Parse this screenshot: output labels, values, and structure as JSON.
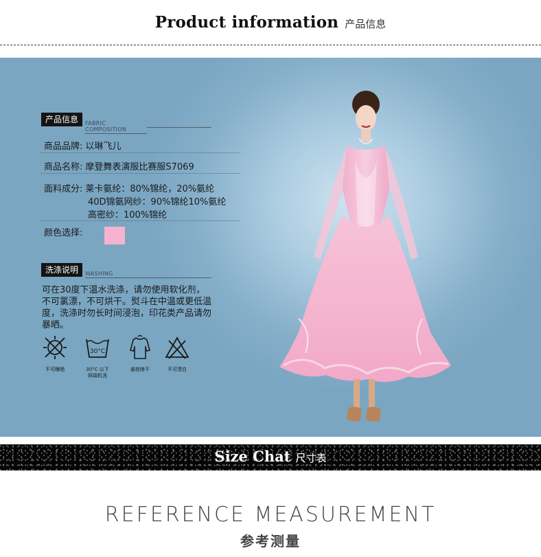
{
  "header": {
    "title_en": "Product  information",
    "title_cn": "产品信息"
  },
  "product_info": {
    "tag_label": "产品信息",
    "tag_sub": "FABRIC COMPOSITION",
    "brand_label": "商品品牌:",
    "brand_value": "以琳飞儿",
    "name_label": "商品名称:",
    "name_value": "摩登舞表演服比赛服S7069",
    "fabric_label": "面料成分:",
    "fabric_lines": [
      "莱卡氨纶：80%锦纶，20%氨纶",
      "40D锦氨网纱：90%锦纶10%氨纶",
      "高密纱：100%锦纶"
    ],
    "color_label": "颜色选择:",
    "color_swatch": "#f5b3cf"
  },
  "washing": {
    "tag_label": "洗涤说明",
    "tag_sub": "WASHING",
    "text": "可在30度下温水洗涤，请勿使用软化剂，不可氯漂，不可烘干。熨斗在中温或更低温度，洗涤时勿长时间浸泡，印花类产品请勿暴晒。",
    "icons": [
      {
        "icon": "no-sun-drying-icon",
        "label": "不可曝晒"
      },
      {
        "icon": "wash-30c-icon",
        "label": "30°C 以下\n网袋机洗",
        "temp": "30°C"
      },
      {
        "icon": "hang-dry-icon",
        "label": "悬挂晾干"
      },
      {
        "icon": "no-bleach-icon",
        "label": "不可漂白"
      }
    ]
  },
  "size_band": {
    "title_en": "Size  Chat",
    "title_cn": "尺寸表"
  },
  "reference": {
    "title_en": "REFERENCE MEASUREMENT",
    "title_cn": "参考测量"
  },
  "colors": {
    "panel_bg": "#8fb6cf",
    "dress_pink": "#f5b3cf",
    "band_bg": "#050505"
  }
}
